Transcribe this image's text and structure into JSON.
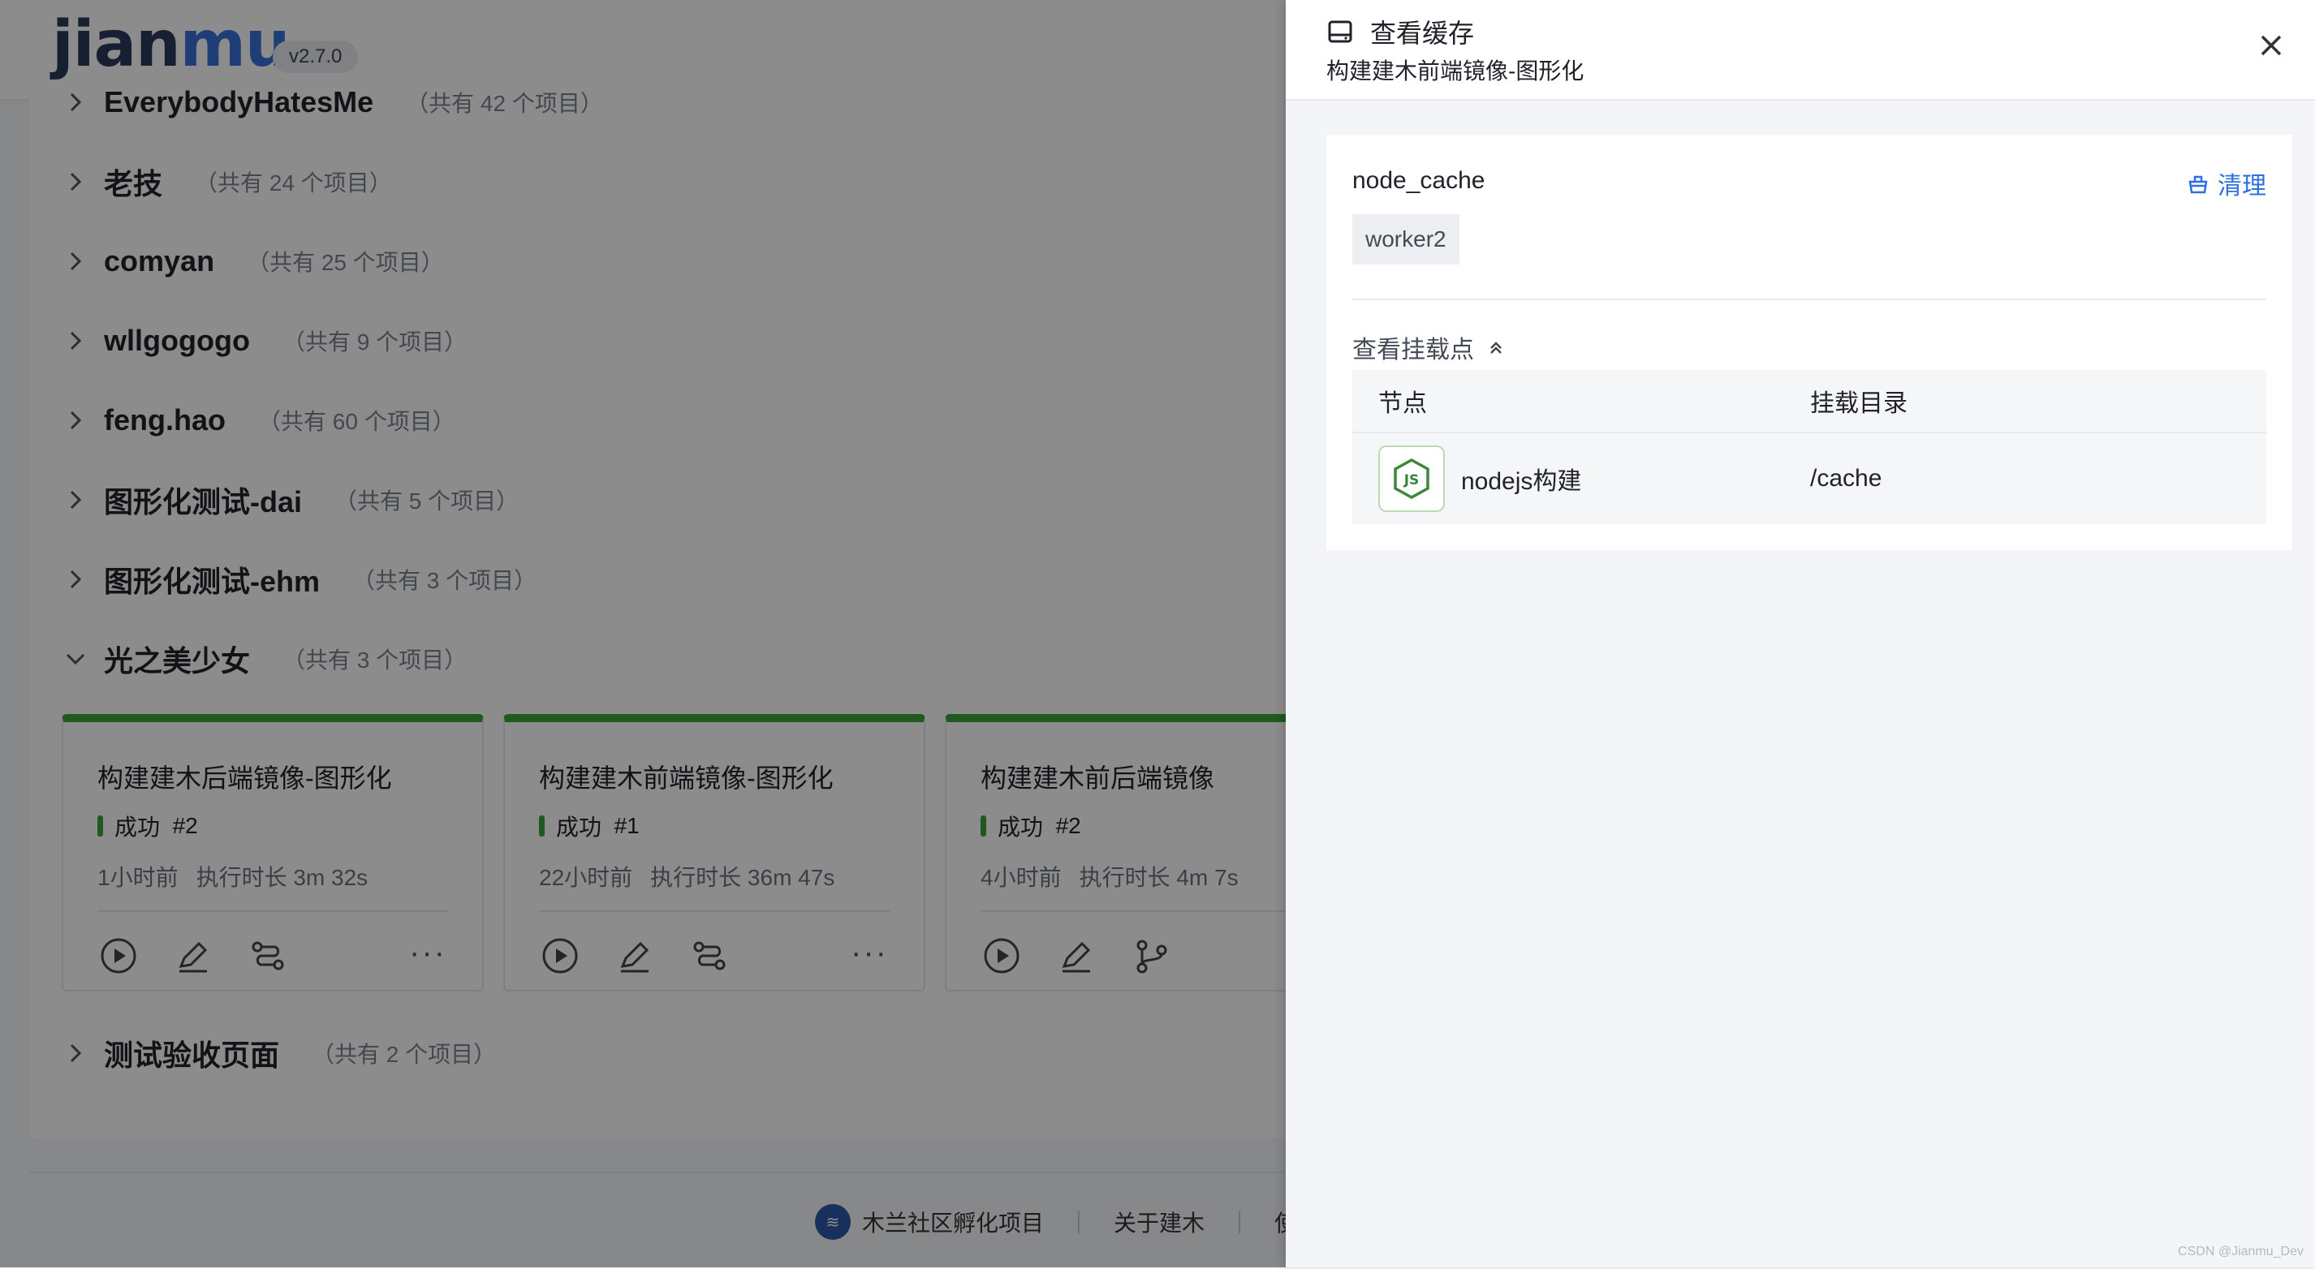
{
  "header": {
    "logo_main": "jian",
    "logo_accent": "mu",
    "version": "v2.7.0"
  },
  "groups": [
    {
      "name": "EverybodyHatesMe",
      "count": "（共有 42 个项目）",
      "expanded": false
    },
    {
      "name": "老技",
      "count": "（共有 24 个项目）",
      "expanded": false
    },
    {
      "name": "comyan",
      "count": "（共有 25 个项目）",
      "expanded": false
    },
    {
      "name": "wllgogogo",
      "count": "（共有 9 个项目）",
      "expanded": false
    },
    {
      "name": "feng.hao",
      "count": "（共有 60 个项目）",
      "expanded": false
    },
    {
      "name": "图形化测试-dai",
      "count": "（共有 5 个项目）",
      "expanded": false
    },
    {
      "name": "图形化测试-ehm",
      "count": "（共有 3 个项目）",
      "expanded": false
    },
    {
      "name": "光之美少女",
      "count": "（共有 3 个项目）",
      "expanded": true
    },
    {
      "name": "测试验收页面",
      "count": "（共有 2 个项目）",
      "expanded": false
    }
  ],
  "cards": [
    {
      "title": "构建建木后端镜像-图形化",
      "status": "成功",
      "run": "#2",
      "time": "1小时前",
      "duration": "执行时长 3m 32s"
    },
    {
      "title": "构建建木前端镜像-图形化",
      "status": "成功",
      "run": "#1",
      "time": "22小时前",
      "duration": "执行时长 36m 47s"
    },
    {
      "title": "构建建木前后端镜像",
      "status": "成功",
      "run": "#2",
      "time": "4小时前",
      "duration": "执行时长 4m 7s"
    }
  ],
  "card_more": "···",
  "footer": {
    "incubator": "木兰社区孵化项目",
    "about": "关于建木",
    "use": "使"
  },
  "drawer": {
    "title": "查看缓存",
    "subtitle": "构建建木前端镜像-图形化",
    "cache_name": "node_cache",
    "clean_label": "清理",
    "worker_tag": "worker2",
    "mount_toggle": "查看挂载点",
    "table": {
      "col_node": "节点",
      "col_dir": "挂载目录",
      "rows": [
        {
          "node": "nodejs构建",
          "dir": "/cache"
        }
      ]
    }
  },
  "watermark": "CSDN @Jianmu_Dev",
  "colors": {
    "success": "#3aa33a",
    "link": "#2f6fe0",
    "brand": "#2a3a5c",
    "accent": "#3a6fd8"
  }
}
